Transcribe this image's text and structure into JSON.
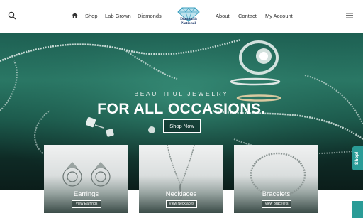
{
  "header": {
    "nav_left": [
      "Shop",
      "Lab Grown",
      "Diamonds"
    ],
    "nav_right": [
      "About",
      "Contact",
      "My Account"
    ],
    "logo_text_line1": "Diamonds",
    "logo_text_line2": "National",
    "icons": {
      "search": "search-icon",
      "home": "home-icon",
      "menu": "hamburger-menu-icon"
    },
    "logo_color": "#1f3a6b"
  },
  "hero": {
    "kicker": "BEAUTIFUL JEWELRY",
    "title": "FOR ALL OCCASIONS.",
    "button": "Shop Now"
  },
  "shop_tab": {
    "label": "Shop!",
    "color": "#2a9c97"
  },
  "cards": [
    {
      "label": "Earrings",
      "button": "View Earrings"
    },
    {
      "label": "Necklaces",
      "button": "View Necklaces"
    },
    {
      "label": "Bracelets",
      "button": "View Bracelets"
    }
  ]
}
